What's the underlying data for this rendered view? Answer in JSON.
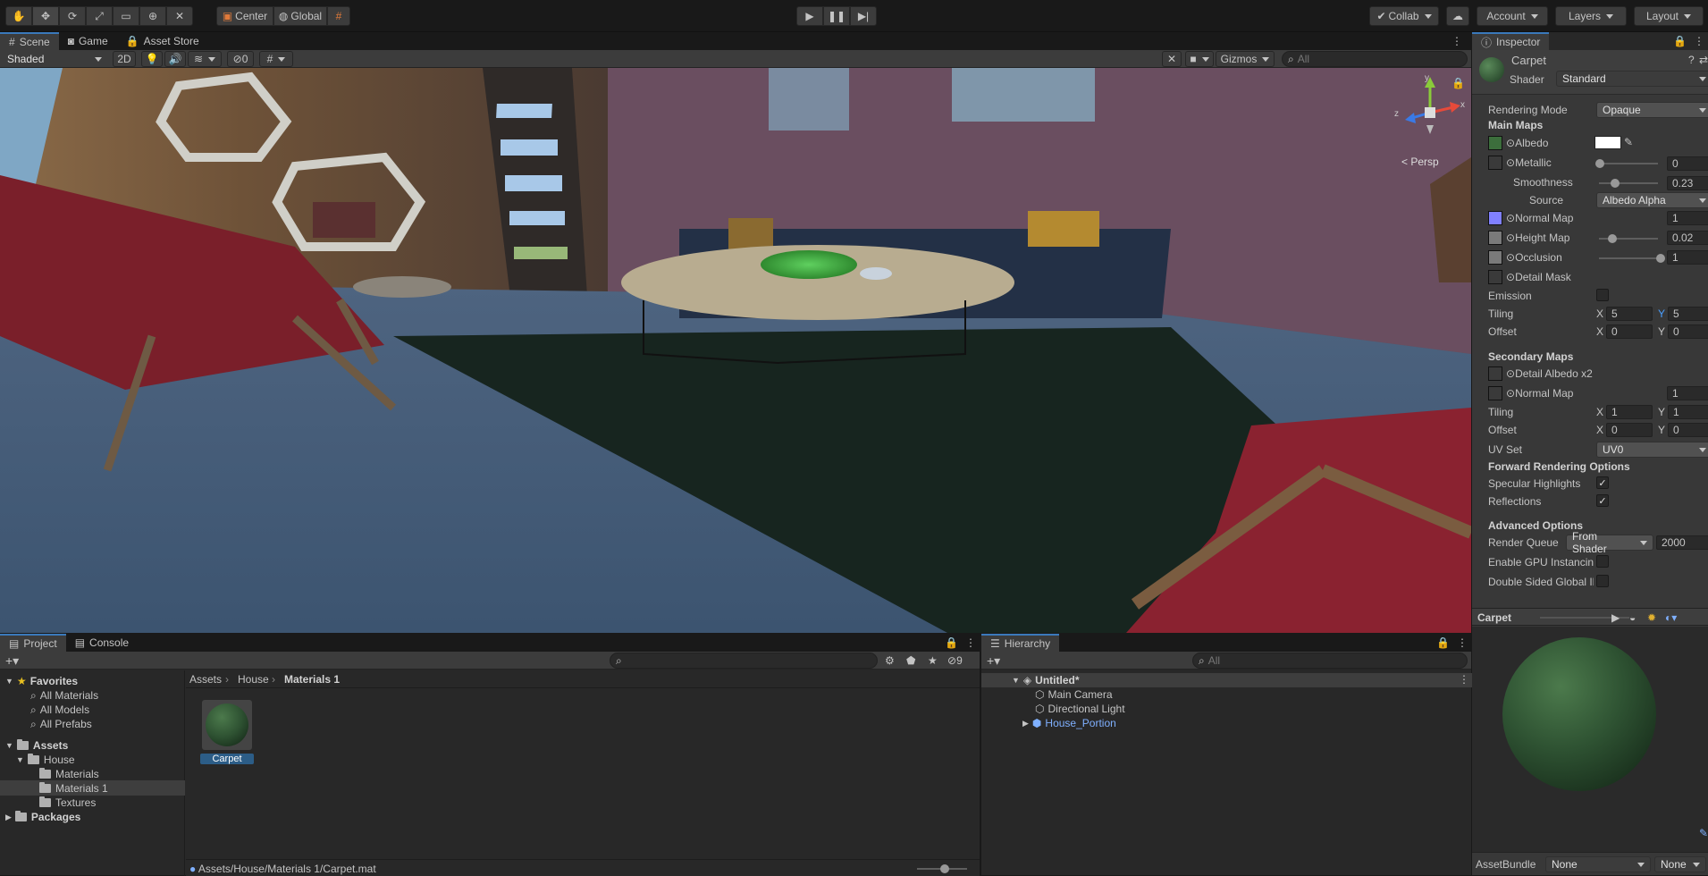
{
  "toolbar": {
    "center_label": "Center",
    "global_label": "Global",
    "collab_label": "Collab",
    "account_label": "Account",
    "layers_label": "Layers",
    "layout_label": "Layout"
  },
  "scene_panel": {
    "tabs": [
      {
        "label": "Scene"
      },
      {
        "label": "Game"
      },
      {
        "label": "Asset Store"
      }
    ],
    "shading_mode": "Shaded",
    "mode_2d": "2D",
    "hidden_count": "0",
    "gizmos_label": "Gizmos",
    "search_placeholder": "All",
    "persp_label": "Persp",
    "gizmo_axes": {
      "x": "x",
      "y": "y",
      "z": "z"
    }
  },
  "inspector": {
    "tab_label": "Inspector",
    "material_name": "Carpet",
    "shader_label": "Shader",
    "shader_value": "Standard",
    "rendering_mode_label": "Rendering Mode",
    "rendering_mode_value": "Opaque",
    "main_maps_label": "Main Maps",
    "albedo_label": "Albedo",
    "metallic_label": "Metallic",
    "metallic_value": "0",
    "smoothness_label": "Smoothness",
    "smoothness_value": "0.23",
    "source_label": "Source",
    "source_value": "Albedo Alpha",
    "normal_map_label": "Normal Map",
    "normal_map_value": "1",
    "height_map_label": "Height Map",
    "height_map_value": "0.02",
    "occlusion_label": "Occlusion",
    "occlusion_value": "1",
    "detail_mask_label": "Detail Mask",
    "emission_label": "Emission",
    "tiling_label": "Tiling",
    "tiling_x": "5",
    "tiling_y": "5",
    "offset_label": "Offset",
    "offset_x": "0",
    "offset_y": "0",
    "x_label": "X",
    "y_label": "Y",
    "secondary_maps_label": "Secondary Maps",
    "detail_albedo_label": "Detail Albedo x2",
    "sec_normal_map_label": "Normal Map",
    "sec_normal_map_value": "1",
    "sec_tiling_x": "1",
    "sec_tiling_y": "1",
    "sec_offset_x": "0",
    "sec_offset_y": "0",
    "uv_set_label": "UV Set",
    "uv_set_value": "UV0",
    "forward_label": "Forward Rendering Options",
    "specular_label": "Specular Highlights",
    "reflections_label": "Reflections",
    "advanced_label": "Advanced Options",
    "render_queue_label": "Render Queue",
    "render_queue_mode": "From Shader",
    "render_queue_value": "2000",
    "gpu_instancing_label": "Enable GPU Instancing",
    "double_sided_label": "Double Sided Global Illumination",
    "preview_title": "Carpet",
    "asset_bundle_label": "AssetBundle",
    "asset_bundle_value": "None",
    "asset_bundle_variant": "None"
  },
  "project_panel": {
    "tabs": [
      {
        "label": "Project"
      },
      {
        "label": "Console"
      }
    ],
    "hidden_count": "9",
    "favorites_label": "Favorites",
    "favorites": [
      "All Materials",
      "All Models",
      "All Prefabs"
    ],
    "assets_label": "Assets",
    "house_label": "House",
    "house_children": [
      "Materials",
      "Materials 1",
      "Textures"
    ],
    "packages_label": "Packages",
    "breadcrumb": [
      "Assets",
      "House",
      "Materials 1"
    ],
    "asset_item": "Carpet",
    "status_path": "Assets/House/Materials 1/Carpet.mat"
  },
  "hierarchy_panel": {
    "tab_label": "Hierarchy",
    "search_placeholder": "All",
    "scene_name": "Untitled*",
    "objects": [
      {
        "label": "Main Camera"
      },
      {
        "label": "Directional Light"
      },
      {
        "label": "House_Portion"
      }
    ]
  },
  "colors": {
    "albedo_swatch": "#3c6e3c",
    "normal_swatch": "#8080ff",
    "accent": "#3a79bb",
    "prefab_text": "#7fb0ff"
  }
}
